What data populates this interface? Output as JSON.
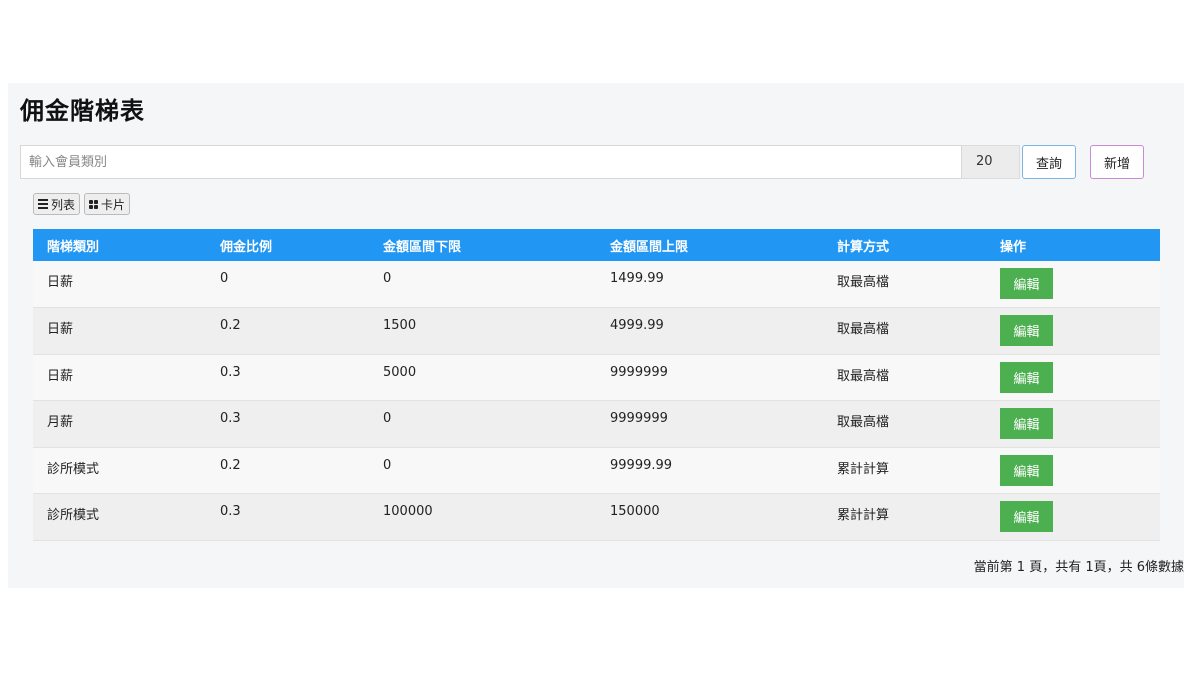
{
  "page": {
    "title": "佣金階梯表"
  },
  "search": {
    "placeholder": "輸入會員類別",
    "page_size": "20",
    "query_label": "查詢",
    "add_label": "新增"
  },
  "view_toggle": {
    "list_label": "列表",
    "card_label": "卡片"
  },
  "table": {
    "columns": [
      "階梯類別",
      "佣金比例",
      "金額區間下限",
      "金額區間上限",
      "計算方式",
      "操作"
    ],
    "edit_label": "編輯",
    "rows": [
      [
        "日薪",
        "0",
        "0",
        "1499.99",
        "取最高檔"
      ],
      [
        "日薪",
        "0.2",
        "1500",
        "4999.99",
        "取最高檔"
      ],
      [
        "日薪",
        "0.3",
        "5000",
        "9999999",
        "取最高檔"
      ],
      [
        "月薪",
        "0.3",
        "0",
        "9999999",
        "取最高檔"
      ],
      [
        "診所模式",
        "0.2",
        "0",
        "99999.99",
        "累計計算"
      ],
      [
        "診所模式",
        "0.3",
        "100000",
        "150000",
        "累計計算"
      ]
    ]
  },
  "pagination": {
    "info": "當前第 1 頁，共有 1頁，共 6條數據"
  },
  "colors": {
    "header_bg": "#2196f3",
    "edit_button": "#4caf50",
    "query_border": "#7fb3e0",
    "add_border": "#c98ad8"
  }
}
